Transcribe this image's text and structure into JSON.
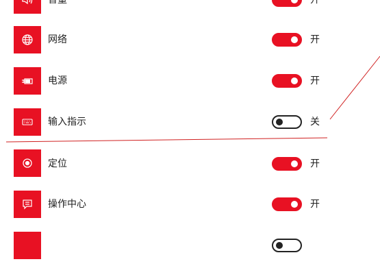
{
  "settings": {
    "items": [
      {
        "label": "音量",
        "icon": "speaker-icon",
        "state_text": "开",
        "on": true
      },
      {
        "label": "网络",
        "icon": "globe-icon",
        "state_text": "开",
        "on": true
      },
      {
        "label": "电源",
        "icon": "battery-plug-icon",
        "state_text": "开",
        "on": true
      },
      {
        "label": "输入指示",
        "icon": "keyboard-icon",
        "state_text": "关",
        "on": false
      },
      {
        "label": "定位",
        "icon": "location-target-icon",
        "state_text": "开",
        "on": true
      },
      {
        "label": "操作中心",
        "icon": "action-center-icon",
        "state_text": "开",
        "on": true
      },
      {
        "label": "",
        "icon": "unknown-icon",
        "state_text": "",
        "on": false
      }
    ]
  },
  "colors": {
    "accent": "#e81123",
    "toggle_off_border": "#222222",
    "annotation_line": "#d02020"
  }
}
